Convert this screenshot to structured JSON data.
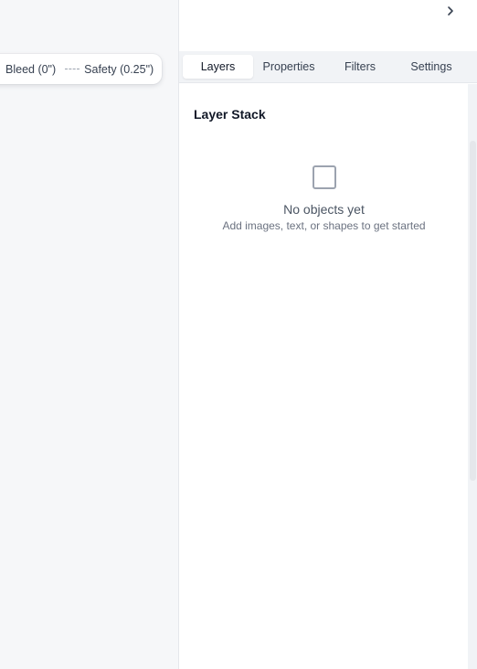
{
  "legend": {
    "bleed_label": "Bleed (0\")",
    "safety_label": "Safety (0.25\")"
  },
  "panel": {
    "expand_icon": "chevron-right-icon",
    "tabs": [
      {
        "label": "Layers",
        "active": true
      },
      {
        "label": "Properties",
        "active": false
      },
      {
        "label": "Filters",
        "active": false
      },
      {
        "label": "Settings",
        "active": false
      }
    ],
    "section_title": "Layer Stack",
    "empty_state": {
      "icon": "square-outline-icon",
      "title": "No objects yet",
      "subtitle": "Add images, text, or shapes to get started"
    }
  },
  "colors": {
    "canvas_bg": "#f6f7f9",
    "panel_bg": "#ffffff",
    "tab_bar_bg": "#f1f3f6"
  }
}
